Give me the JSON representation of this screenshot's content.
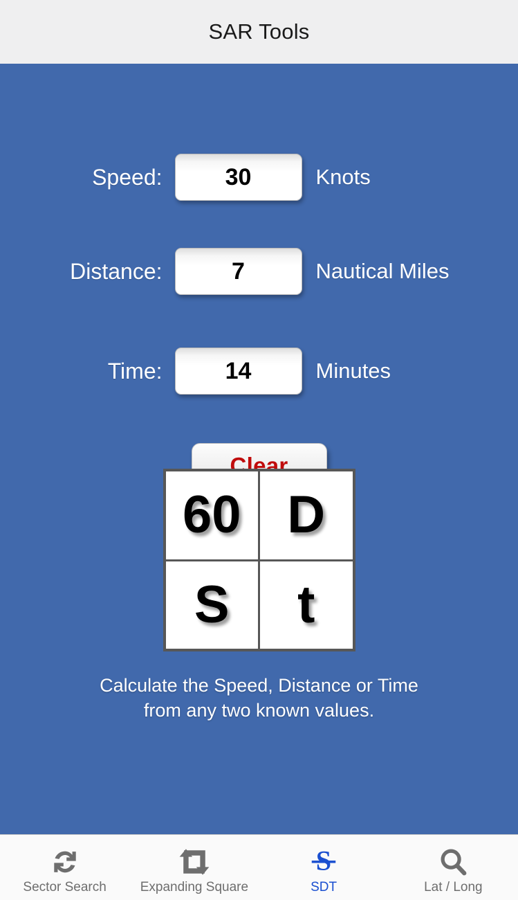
{
  "header": {
    "title": "SAR Tools"
  },
  "theme": {
    "background": "#4169ac",
    "header_bg": "#efeff0",
    "tabbar_bg": "#fafafa",
    "accent": "#1a4fd0",
    "clear_text": "#c00c0c",
    "inactive_tab": "#6e6e6e"
  },
  "form": {
    "fields": [
      {
        "label": "Speed:",
        "value": "30",
        "unit": "Knots"
      },
      {
        "label": "Distance:",
        "value": "7",
        "unit": "Nautical Miles"
      },
      {
        "label": "Time:",
        "value": "14",
        "unit": "Minutes"
      }
    ],
    "clear_label": "Clear"
  },
  "formula": {
    "cells": [
      "60",
      "D",
      "S",
      "t"
    ],
    "caption_line1": "Calculate the Speed, Distance or Time",
    "caption_line2": "from any two known values."
  },
  "tabbar": {
    "items": [
      {
        "label": "Sector Search",
        "icon": "sync-arrows-icon",
        "active": false
      },
      {
        "label": "Expanding Square",
        "icon": "retweet-arrows-icon",
        "active": false
      },
      {
        "label": "SDT",
        "icon": "s-over-line-icon",
        "active": true
      },
      {
        "label": "Lat / Long",
        "icon": "magnifier-icon",
        "active": false
      }
    ]
  }
}
